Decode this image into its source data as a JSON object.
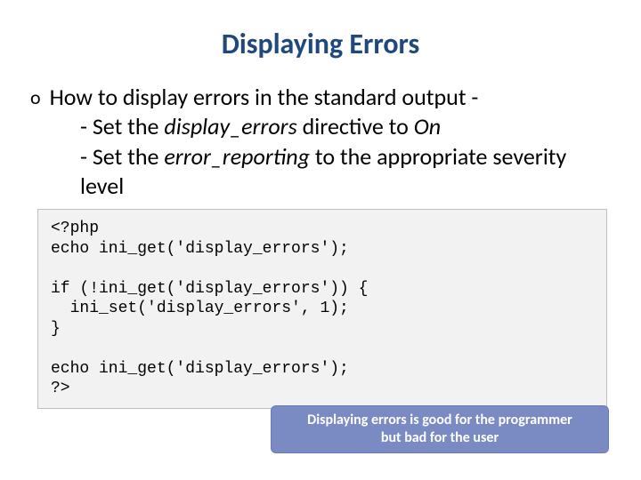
{
  "title": "Displaying Errors",
  "bullet_marker": "o",
  "main_bullet": "How to display errors in the standard output -",
  "sub": {
    "item1_prefix": "- Set the ",
    "item1_dir": "display_errors",
    "item1_mid": " directive to ",
    "item1_val": "On",
    "item2_prefix": "- Set the ",
    "item2_dir": "error_reporting",
    "item2_suffix": " to the appropriate severity level"
  },
  "code": "<?php\necho ini_get('display_errors');\n\nif (!ini_get('display_errors')) {\n  ini_set('display_errors', 1);\n}\n\necho ini_get('display_errors');\n?>",
  "note_line1": "Displaying errors is good for the programmer",
  "note_line2": "but bad for the user"
}
